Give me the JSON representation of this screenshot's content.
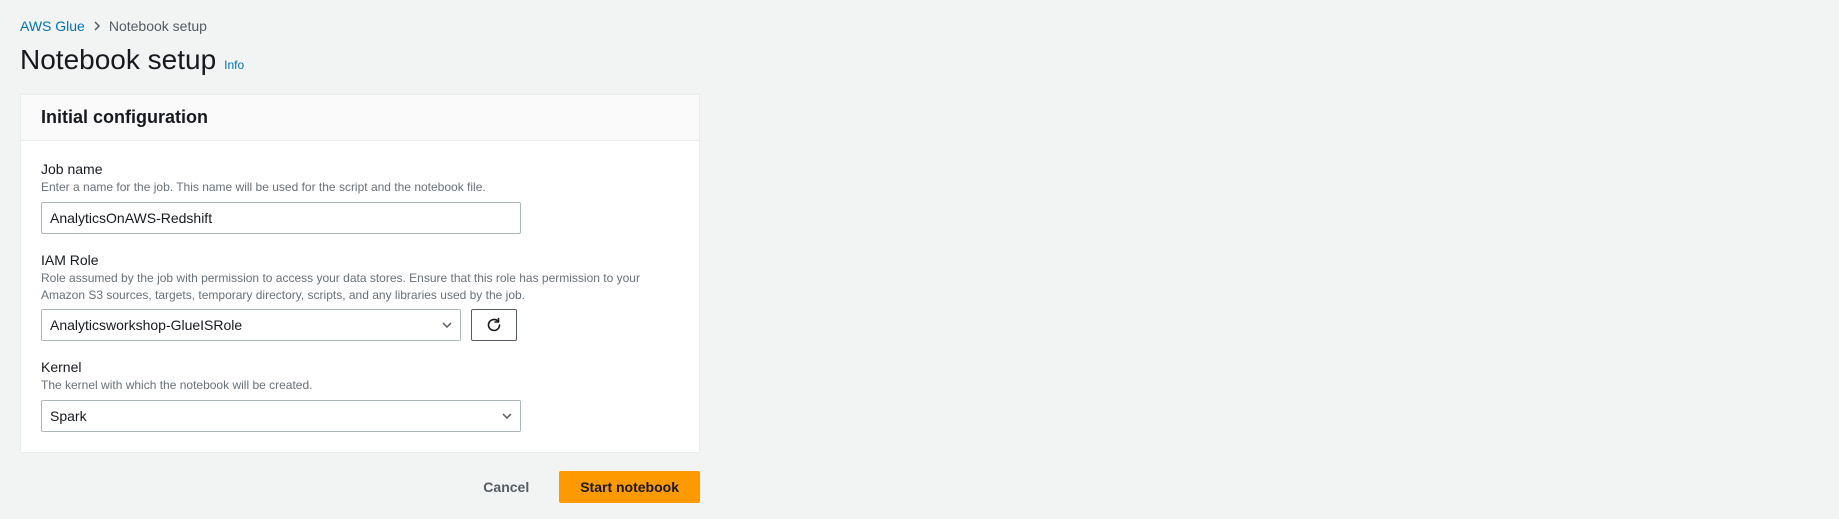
{
  "breadcrumb": {
    "root": "AWS Glue",
    "current": "Notebook setup"
  },
  "header": {
    "title": "Notebook setup",
    "info": "Info"
  },
  "panel": {
    "title": "Initial configuration",
    "job_name": {
      "label": "Job name",
      "hint": "Enter a name for the job. This name will be used for the script and the notebook file.",
      "value": "AnalyticsOnAWS-Redshift"
    },
    "iam_role": {
      "label": "IAM Role",
      "hint": "Role assumed by the job with permission to access your data stores. Ensure that this role has permission to your Amazon S3 sources, targets, temporary directory, scripts, and any libraries used by the job.",
      "value": "Analyticsworkshop-GlueISRole"
    },
    "kernel": {
      "label": "Kernel",
      "hint": "The kernel with which the notebook will be created.",
      "value": "Spark"
    }
  },
  "actions": {
    "cancel": "Cancel",
    "start": "Start notebook"
  }
}
